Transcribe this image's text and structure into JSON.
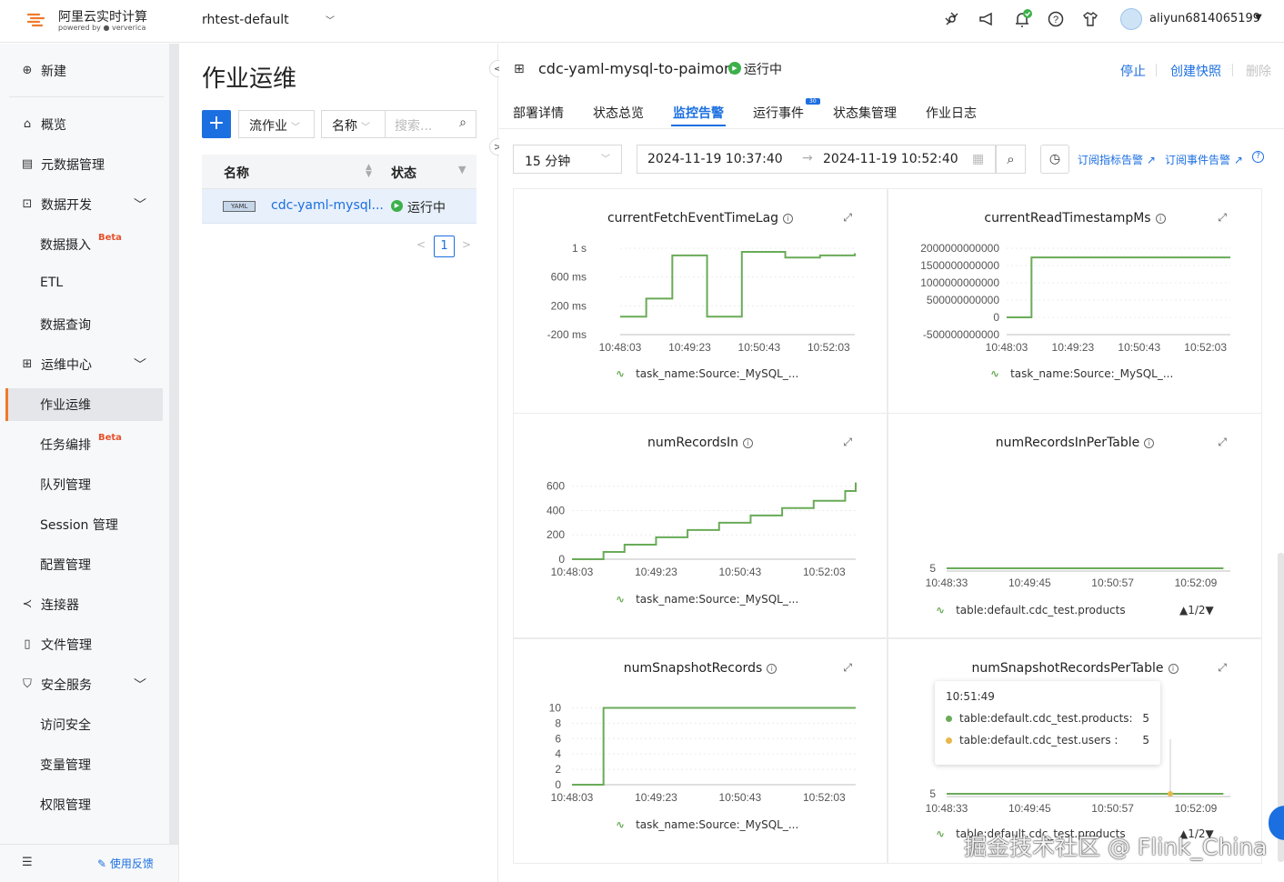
{
  "topbar": {
    "brand_name": "阿里云实时计算",
    "brand_powered": "powered by",
    "brand_partner": "ververica",
    "workspace": "rhtest-default",
    "user": "aliyun6814065199",
    "accent": "#1c6fe0"
  },
  "sidebar": {
    "items": [
      {
        "label": "新建",
        "icon": "plus-circle-icon"
      },
      {
        "label": "概览",
        "icon": "home-icon"
      },
      {
        "label": "元数据管理",
        "icon": "database-icon"
      },
      {
        "label": "数据开发",
        "icon": "code-icon"
      },
      {
        "label": "数据摄入",
        "badge": "Beta"
      },
      {
        "label": "ETL"
      },
      {
        "label": "数据查询"
      },
      {
        "label": "运维中心",
        "icon": "ops-icon"
      },
      {
        "label": "作业运维"
      },
      {
        "label": "任务编排",
        "badge": "Beta"
      },
      {
        "label": "队列管理"
      },
      {
        "label": "Session 管理"
      },
      {
        "label": "配置管理"
      },
      {
        "label": "连接器",
        "icon": "share-icon"
      },
      {
        "label": "文件管理",
        "icon": "file-icon"
      },
      {
        "label": "安全服务",
        "icon": "shield-icon"
      },
      {
        "label": "访问安全"
      },
      {
        "label": "变量管理"
      },
      {
        "label": "权限管理"
      }
    ],
    "feedback": "使用反馈"
  },
  "jobs": {
    "title": "作业运维",
    "filter_type": "流作业",
    "filter_field": "名称",
    "search_placeholder": "搜索...",
    "col_name": "名称",
    "col_status": "状态",
    "rows": [
      {
        "tag": "YAML",
        "name": "cdc-yaml-mysql...",
        "status": "运行中"
      }
    ],
    "page": "1"
  },
  "job": {
    "name": "cdc-yaml-mysql-to-paimon",
    "status": "运行中",
    "actions": {
      "stop": "停止",
      "snapshot": "创建快照",
      "delete": "删除"
    },
    "tabs": [
      "部署详情",
      "状态总览",
      "监控告警",
      "运行事件",
      "状态集管理",
      "作业日志"
    ],
    "events_badge": "30",
    "time_range": "15 分钟",
    "start_time": "2024-11-19 10:37:40",
    "end_time": "2024-11-19 10:52:40",
    "subscribe_metric": "订阅指标告警",
    "subscribe_event": "订阅事件告警"
  },
  "chart_data": [
    {
      "type": "line",
      "title": "currentFetchEventTimeLag",
      "xticks": [
        "10:48:03",
        "10:49:23",
        "10:50:43",
        "10:52:03"
      ],
      "yticks": [
        "1 s",
        "600 ms",
        "200 ms",
        "-200 ms"
      ],
      "series": [
        {
          "name": "task_name:Source:_MySQL_...",
          "x": [
            "10:48:03",
            "10:48:23",
            "10:48:33",
            "10:48:53",
            "10:49:03",
            "10:49:33",
            "10:49:43",
            "10:50:13",
            "10:50:23",
            "10:51:03",
            "10:51:13",
            "10:51:43",
            "10:51:53",
            "10:52:23",
            "10:52:33"
          ],
          "values": [
            0.05,
            0.05,
            0.3,
            0.3,
            0.9,
            0.9,
            0.05,
            0.05,
            0.95,
            0.95,
            0.87,
            0.87,
            0.9,
            0.9,
            0.93
          ]
        }
      ]
    },
    {
      "type": "line",
      "title": "currentReadTimestampMs",
      "xticks": [
        "10:48:03",
        "10:49:23",
        "10:50:43",
        "10:52:03"
      ],
      "yticks": [
        "2000000000000",
        "1500000000000",
        "1000000000000",
        "500000000000",
        "0",
        "-500000000000"
      ],
      "series": [
        {
          "name": "task_name:Source:_MySQL_...",
          "x": [
            "10:48:03",
            "10:48:23",
            "10:48:33",
            "10:52:33"
          ],
          "values": [
            0,
            0,
            1732000000000,
            1732000000000
          ]
        }
      ]
    },
    {
      "type": "line",
      "title": "numRecordsIn",
      "xticks": [
        "10:48:03",
        "10:49:23",
        "10:50:43",
        "10:52:03"
      ],
      "yticks": [
        "600",
        "400",
        "200",
        "0"
      ],
      "series": [
        {
          "name": "task_name:Source:_MySQL_...",
          "x": [
            "10:48:03",
            "10:48:33",
            "10:48:53",
            "10:49:23",
            "10:49:53",
            "10:50:23",
            "10:50:53",
            "10:51:23",
            "10:51:53",
            "10:52:23",
            "10:52:33"
          ],
          "values": [
            0,
            60,
            120,
            180,
            240,
            300,
            360,
            420,
            480,
            560,
            630
          ]
        }
      ]
    },
    {
      "type": "line",
      "title": "numRecordsInPerTable",
      "xticks": [
        "10:48:33",
        "10:49:45",
        "10:50:57",
        "10:52:09"
      ],
      "yticks": [
        "5"
      ],
      "series": [
        {
          "name": "table:default.cdc_test.products",
          "x": [
            "10:48:33",
            "10:52:33"
          ],
          "values": [
            5,
            5
          ]
        }
      ],
      "legend_page": "1/2"
    },
    {
      "type": "line",
      "title": "numSnapshotRecords",
      "xticks": [
        "10:48:03",
        "10:49:23",
        "10:50:43",
        "10:52:03"
      ],
      "yticks": [
        "10",
        "8",
        "6",
        "4",
        "2",
        "0"
      ],
      "series": [
        {
          "name": "task_name:Source:_MySQL_...",
          "x": [
            "10:48:03",
            "10:48:23",
            "10:48:33",
            "10:52:33"
          ],
          "values": [
            0,
            0,
            10,
            10
          ]
        }
      ]
    },
    {
      "type": "line",
      "title": "numSnapshotRecordsPerTable",
      "xticks": [
        "10:48:33",
        "10:49:45",
        "10:50:57",
        "10:52:09"
      ],
      "yticks": [
        "5"
      ],
      "series": [
        {
          "name": "table:default.cdc_test.products",
          "x": [
            "10:48:33",
            "10:52:33"
          ],
          "values": [
            5,
            5
          ]
        }
      ],
      "legend_page": "1/2",
      "tooltip": {
        "time": "10:51:49",
        "rows": [
          {
            "label": "table:default.cdc_test.products:",
            "value": "5",
            "color": "#6aab58"
          },
          {
            "label": "table:default.cdc_test.users     :",
            "value": "5",
            "color": "#e8b84a"
          }
        ]
      }
    }
  ],
  "watermark": "掘金技术社区 @ Flink_China"
}
